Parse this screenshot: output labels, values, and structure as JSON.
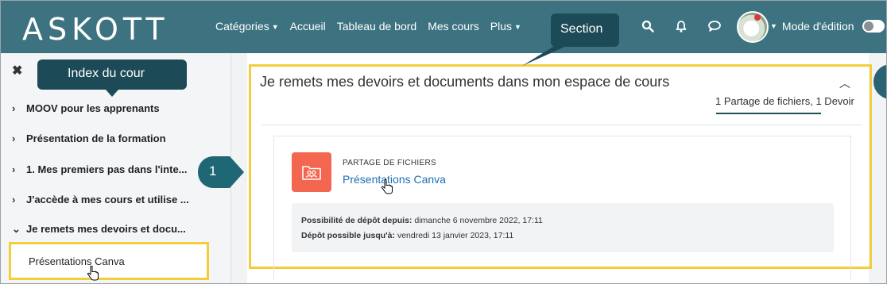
{
  "navbar": {
    "logo": "ASKOTT",
    "menu": [
      {
        "label": "Catégories",
        "has_dropdown": true
      },
      {
        "label": "Accueil",
        "has_dropdown": false
      },
      {
        "label": "Tableau de bord",
        "has_dropdown": false
      },
      {
        "label": "Mes cours",
        "has_dropdown": false
      },
      {
        "label": "Plus",
        "has_dropdown": true
      }
    ],
    "icons": [
      "search-icon",
      "bell-icon",
      "chat-icon"
    ],
    "edit_mode_label": "Mode d'édition",
    "edit_mode_on": false,
    "bg_color": "#3d7380"
  },
  "sidebar": {
    "tooltip": "Index du cour",
    "items": [
      {
        "label": "MOOV pour les apprenants",
        "expanded": false
      },
      {
        "label": "Présentation de la formation",
        "expanded": false
      },
      {
        "label": "1. Mes premiers pas dans l'inte...",
        "expanded": false
      },
      {
        "label": "J'accède à mes cours et utilise ...",
        "expanded": false
      },
      {
        "label": "Je remets mes devoirs et docu...",
        "expanded": true
      }
    ],
    "child": {
      "label": "Présentations Canva"
    }
  },
  "section": {
    "tooltip": "Section",
    "title": "Je remets mes devoirs et documents dans mon espace de cours",
    "summary": "1 Partage de fichiers, 1 Devoir",
    "callout_number": "1",
    "activity": {
      "type": "PARTAGE DE FICHIERS",
      "name": "Présentations Canva",
      "icon": "folder-share-icon",
      "icon_color": "#f3664f",
      "dates": [
        {
          "label": "Possibilité de dépôt depuis:",
          "value": "dimanche 6 novembre 2022, 17:11"
        },
        {
          "label": "Dépôt possible jusqu'à:",
          "value": "vendredi 13 janvier 2023, 17:11"
        }
      ]
    }
  },
  "highlight_color": "#f3cd3d",
  "tooltip_color": "#1d4a57"
}
